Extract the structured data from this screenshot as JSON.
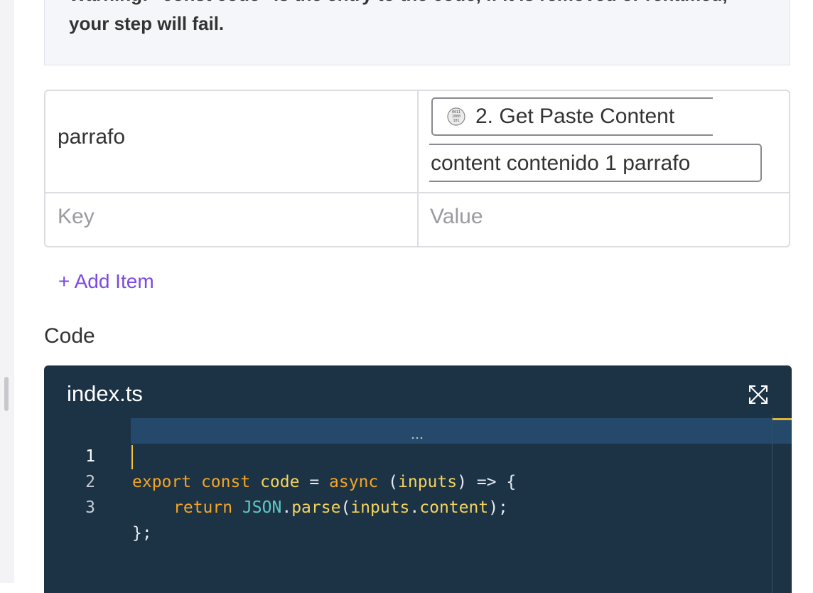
{
  "warning": {
    "text": "Warning: \"const code\" is the entry to the code, if it is removed or renamed, your step will fail."
  },
  "inputs_table": {
    "rows": [
      {
        "key": "parrafo",
        "value_pill": "2. Get Paste Content",
        "value_text": "content contenido 1 parrafo"
      }
    ],
    "key_placeholder": "Key",
    "value_placeholder": "Value"
  },
  "add_item_label": "+ Add Item",
  "code_label": "Code",
  "editor": {
    "file_name": "index.ts",
    "line_numbers": [
      "1",
      "2",
      "3"
    ],
    "lines": {
      "l1": {
        "export": "export",
        "const": "const",
        "code": "code",
        "eq": "=",
        "async": "async",
        "open": "(",
        "inputs": "inputs",
        "close": ")",
        "arrow": "=>",
        "brace": "{"
      },
      "l2": {
        "return": "return",
        "json": "JSON",
        "dot1": ".",
        "parse": "parse",
        "paren": "(",
        "inputs": "inputs",
        "dot2": ".",
        "content": "content",
        "end": ");"
      },
      "l3": {
        "end": "};"
      }
    }
  },
  "colors": {
    "accent": "#7b49e0",
    "editor_bg": "#1c3346",
    "keyword": "#f6a623",
    "identifier": "#f4d35e",
    "class": "#5ec9c4"
  }
}
